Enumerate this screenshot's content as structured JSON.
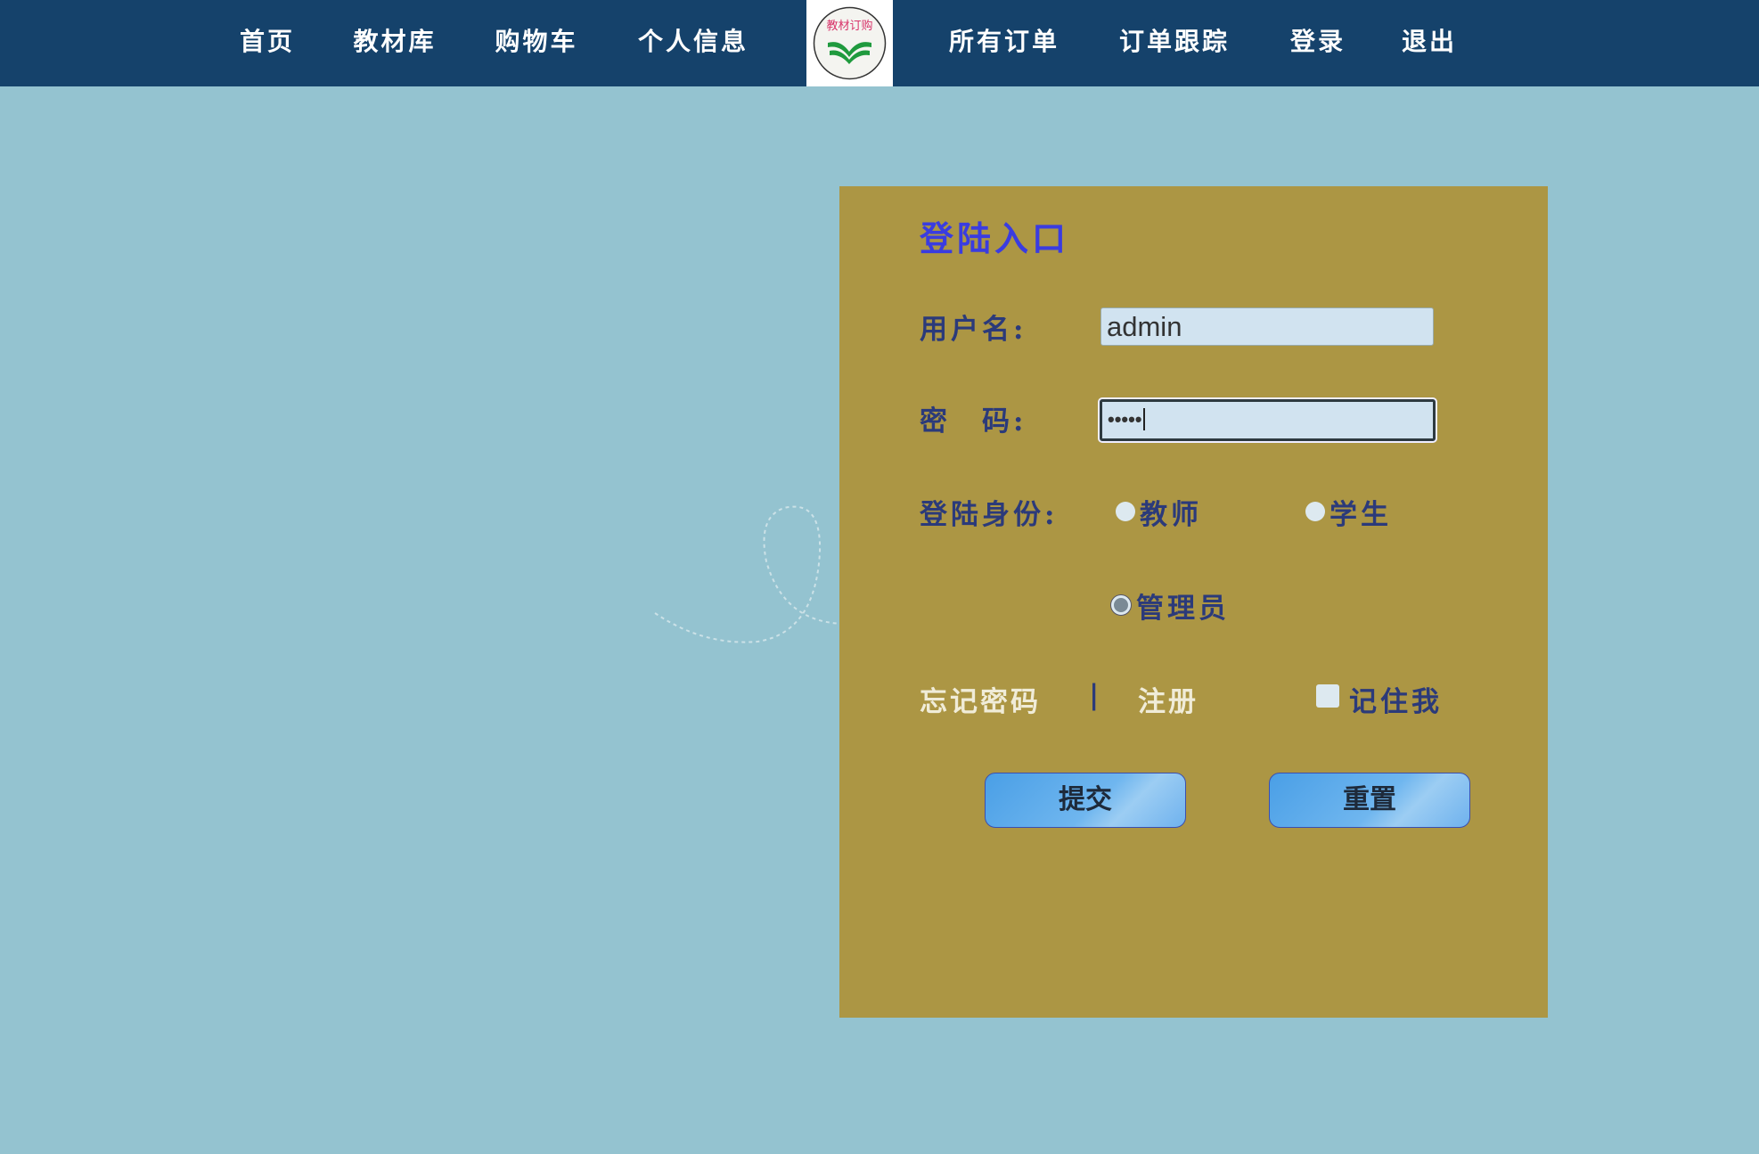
{
  "nav": {
    "items_left": [
      "首页",
      "教材库",
      "购物车",
      "个人信息"
    ],
    "logo_text": "教材订购",
    "items_right": [
      "所有订单",
      "订单跟踪",
      "登录",
      "退出"
    ]
  },
  "login": {
    "title": "登陆入口",
    "username_label": "用户名:",
    "username_value": "admin",
    "password_label": "密　码:",
    "password_value": "•••••",
    "role_label": "登陆身份:",
    "roles": [
      {
        "label": "教师",
        "selected": false
      },
      {
        "label": "学生",
        "selected": false
      },
      {
        "label": "管理员",
        "selected": true
      }
    ],
    "forgot_password": "忘记密码",
    "separator": "|",
    "register": "注册",
    "remember_me": "记住我",
    "submit": "提交",
    "reset": "重置"
  },
  "colors": {
    "nav": "#15426b",
    "background": "#94c3d0",
    "panel": "#ac9644",
    "title": "#3a3ce0"
  }
}
